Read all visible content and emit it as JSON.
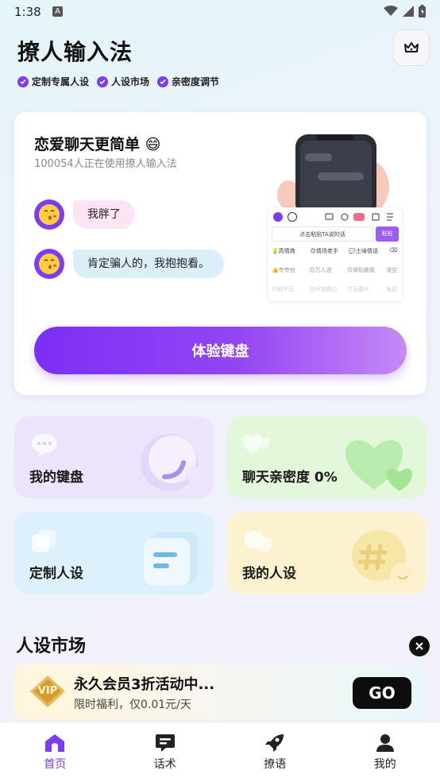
{
  "status_bar": {
    "time": "1:38",
    "notification_letter": "A"
  },
  "header": {
    "title": "撩人输入法",
    "features": [
      "定制专属人设",
      "人设市场",
      "亲密度调节"
    ],
    "accent": "#7b3cf5"
  },
  "main_card": {
    "title": "恋爱聊天更简单 😄",
    "subtitle": "100054人正在使用撩人输入法",
    "chat": [
      {
        "text": "我胖了"
      },
      {
        "text": "肯定骗人的，我抱抱看。"
      }
    ],
    "keyboard_preview": {
      "input_placeholder": "点击粘贴TA说的话",
      "paste_label": "粘贴",
      "row1": [
        "💡高情商",
        "😊情场老手",
        "💬土味情话"
      ],
      "row2": [
        "👍夸夸他",
        "😊万人迷",
        "😊体贴被窝",
        "清空"
      ],
      "row3": [
        "😏假不正",
        "😊只道我心",
        "😊无厘头",
        "发送"
      ]
    },
    "try_button": "体验键盘"
  },
  "tiles": [
    {
      "label": "我的键盘",
      "color": "#ece4fb"
    },
    {
      "label": "聊天亲密度 0%",
      "color": "#e3f8da"
    },
    {
      "label": "定制人设",
      "color": "#dcf1fb"
    },
    {
      "label": "我的人设",
      "color": "#fdf2cf"
    }
  ],
  "market": {
    "title": "人设市场"
  },
  "promo": {
    "badge": "VIP",
    "title": "永久会员3折活动中...",
    "subtitle": "限时福利，仅0.01元/天",
    "go": "GO"
  },
  "tab_bar": [
    {
      "label": "首页",
      "icon": "home-icon",
      "active": true
    },
    {
      "label": "话术",
      "icon": "chat-icon",
      "active": false
    },
    {
      "label": "撩语",
      "icon": "rocket-icon",
      "active": false
    },
    {
      "label": "我的",
      "icon": "user-icon",
      "active": false
    }
  ]
}
